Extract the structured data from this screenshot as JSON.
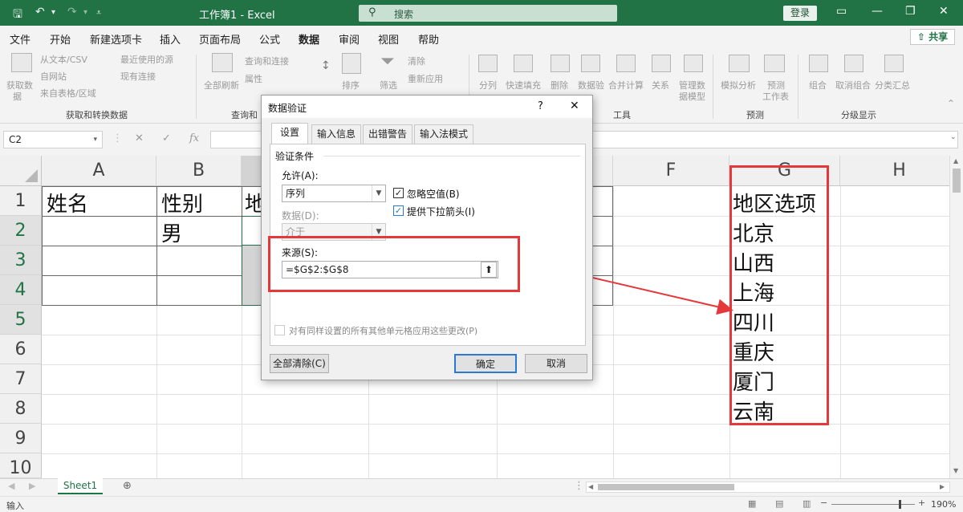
{
  "window": {
    "title": "工作簿1  -  Excel",
    "search_placeholder": "搜索",
    "login_label": "登录",
    "share_label": "共享"
  },
  "menu_tabs": [
    "文件",
    "开始",
    "新建选项卡",
    "插入",
    "页面布局",
    "公式",
    "数据",
    "审阅",
    "视图",
    "帮助"
  ],
  "active_tab": "数据",
  "ribbon": {
    "get_data": "获取数",
    "get_data2": "据",
    "from_text_csv": "从文本/CSV",
    "from_web": "自网站",
    "from_table": "来自表格/区域",
    "recent_sources": "最近使用的源",
    "existing_connections": "现有连接",
    "refresh_all": "全部刷新",
    "queries_connections": "查询和连接",
    "properties": "属性",
    "sort": "排序",
    "filter": "筛选",
    "clear": "清除",
    "reapply": "重新应用",
    "text_to_columns": "分列",
    "flash_fill": "快速填充",
    "remove_duplicates": "删除",
    "remove_duplicates2": "重复值",
    "data_validation": "数据验",
    "consolidate": "合并计算",
    "relationships": "关系",
    "data_model": "管理数",
    "data_model2": "据模型",
    "what_if": "模拟分析",
    "forecast_sheet": "预测",
    "forecast_sheet2": "工作表",
    "group": "组合",
    "ungroup": "取消组合",
    "subtotal": "分类汇总",
    "group_get_transform": "获取和转换数据",
    "group_queries": "查询和",
    "group_tools": "工具",
    "group_forecast": "预测",
    "group_outline": "分级显示"
  },
  "formula_bar": {
    "name_box": "C2",
    "cancel": "✕",
    "enter": "✓",
    "fx": "fx",
    "content": ""
  },
  "columns": [
    "A",
    "B",
    "C",
    "D",
    "E",
    "F",
    "G",
    "H"
  ],
  "rows": [
    "1",
    "2",
    "3",
    "4",
    "5",
    "6",
    "7",
    "8",
    "9",
    "10"
  ],
  "cells": {
    "A1": "姓名",
    "B1": "性别",
    "C1": "地",
    "B2": "男",
    "G1": "地区选项",
    "G2": "北京",
    "G3": "山西",
    "G4": "上海",
    "G5": "四川",
    "G6": "重庆",
    "G7": "厦门",
    "G8": "云南"
  },
  "sheet_tabs": [
    "Sheet1"
  ],
  "status_bar": {
    "mode": "输入",
    "zoom": "190%"
  },
  "dialog": {
    "title": "数据验证",
    "help": "?",
    "tabs": [
      "设置",
      "输入信息",
      "出错警告",
      "输入法模式"
    ],
    "active_tab": "设置",
    "criteria_title": "验证条件",
    "allow_label": "允许(A):",
    "allow_value": "序列",
    "data_label": "数据(D):",
    "data_value": "介于",
    "ignore_blank": "忽略空值(B)",
    "ignore_blank_checked": true,
    "in_cell_dropdown": "提供下拉箭头(I)",
    "in_cell_dropdown_checked": true,
    "source_label": "来源(S):",
    "source_value": "=$G$2:$G$8",
    "apply_all": "对有同样设置的所有其他单元格应用这些更改(P)",
    "clear_all": "全部清除(C)",
    "ok": "确定",
    "cancel": "取消"
  },
  "annotation_color": "#e5383b"
}
